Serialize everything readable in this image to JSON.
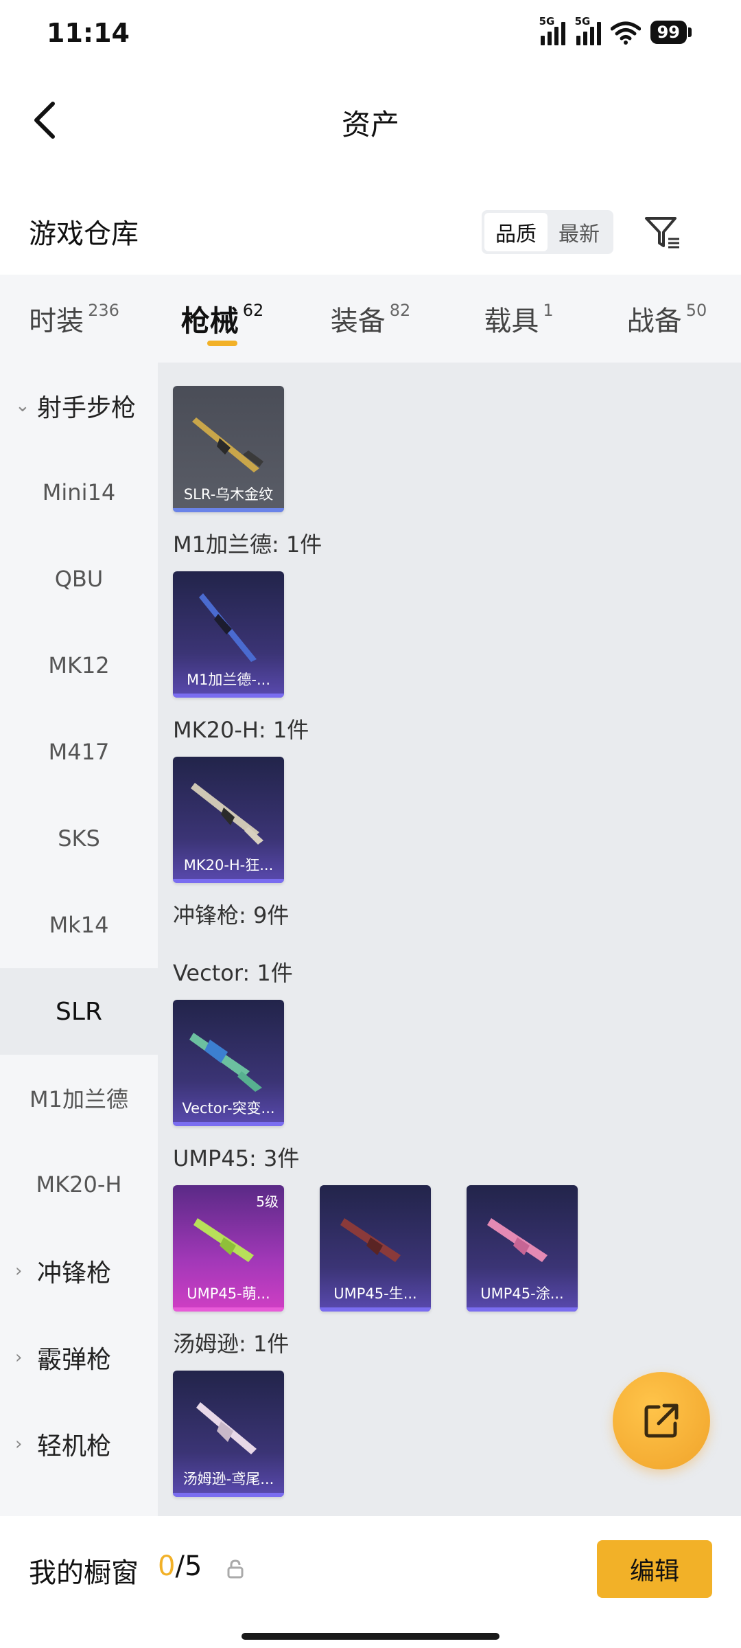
{
  "status": {
    "time": "11:14",
    "signal1": "5G",
    "signal2": "5G",
    "battery": "99"
  },
  "header": {
    "title": "资产"
  },
  "warehouse": {
    "title": "游戏仓库",
    "sort_options": [
      "品质",
      "最新"
    ],
    "active_sort": "品质"
  },
  "tabs": [
    {
      "label": "时装",
      "count": "236"
    },
    {
      "label": "枪械",
      "count": "62"
    },
    {
      "label": "装备",
      "count": "82"
    },
    {
      "label": "载具",
      "count": "1"
    },
    {
      "label": "战备",
      "count": "50"
    }
  ],
  "sidebar": {
    "groups": [
      {
        "label": "射手步枪",
        "expanded": true
      },
      {
        "label": "冲锋枪",
        "expanded": false
      },
      {
        "label": "霰弹枪",
        "expanded": false
      },
      {
        "label": "轻机枪",
        "expanded": false
      }
    ],
    "items": [
      "Mini14",
      "QBU",
      "MK12",
      "M417",
      "SKS",
      "Mk14",
      "SLR",
      "M1加兰德",
      "MK20-H"
    ],
    "active": "SLR"
  },
  "content": {
    "sections": [
      {
        "title": "M1加兰德: 1件"
      },
      {
        "title": "MK20-H: 1件"
      },
      {
        "title": "冲锋枪: 9件"
      },
      {
        "title": "Vector: 1件"
      },
      {
        "title": "UMP45: 3件"
      },
      {
        "title": "汤姆逊: 1件"
      }
    ],
    "cards": [
      {
        "label": "SLR-乌木金纹",
        "level": ""
      },
      {
        "label": "M1加兰德-...",
        "level": ""
      },
      {
        "label": "MK20-H-狂...",
        "level": ""
      },
      {
        "label": "Vector-突变...",
        "level": ""
      },
      {
        "label": "UMP45-萌...",
        "level": "5级"
      },
      {
        "label": "UMP45-生...",
        "level": ""
      },
      {
        "label": "UMP45-涂...",
        "level": ""
      },
      {
        "label": "汤姆逊-鸢尾...",
        "level": ""
      }
    ]
  },
  "showcase": {
    "label": "我的橱窗",
    "current": "0",
    "separator": "/",
    "max": "5",
    "edit_label": "编辑"
  },
  "colors": {
    "accent": "#f2b128",
    "card_bg": "#3b3475",
    "card_pink": "#d03fc4"
  }
}
